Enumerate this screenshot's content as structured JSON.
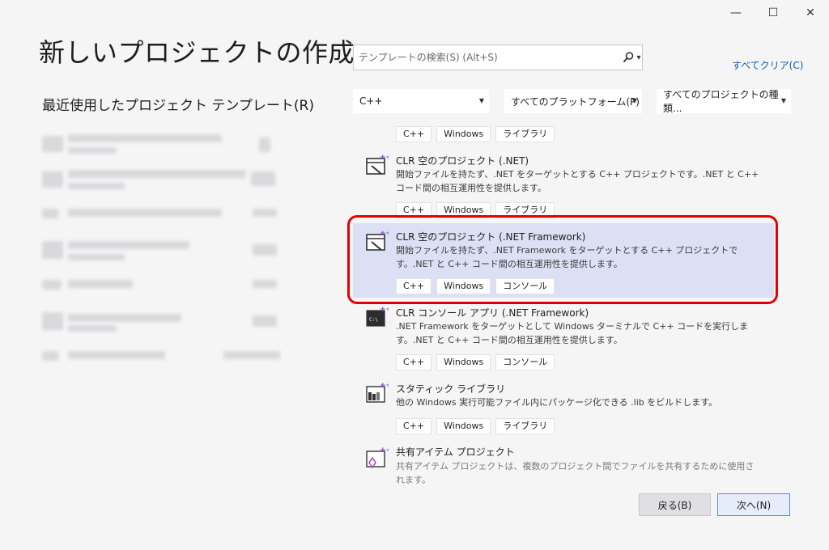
{
  "window": {
    "minimize": "—",
    "maximize": "☐",
    "close": "✕"
  },
  "page_title": "新しいプロジェクトの作成",
  "recent": {
    "title": "最近使用したプロジェクト テンプレート(R)"
  },
  "search": {
    "placeholder": "テンプレートの検索(S) (Alt+S)",
    "icon": "search-icon"
  },
  "clear_all": "すべてクリア(C)",
  "filters": {
    "language": "C++",
    "platform": "すべてのプラットフォーム(P)",
    "project_type": "すべてのプロジェクトの種類..."
  },
  "top_tags": [
    "C++",
    "Windows",
    "ライブラリ"
  ],
  "projects": [
    {
      "name": "CLR 空のプロジェクト (.NET)",
      "desc": "開始ファイルを持たず、.NET をターゲットとする C++ プロジェクトです。.NET と C++ コード間の相互運用性を提供します。",
      "tags": [
        "C++",
        "Windows",
        "ライブラリ"
      ],
      "icon": "clr-empty-project-icon"
    },
    {
      "name": "CLR 空のプロジェクト (.NET Framework)",
      "desc": "開始ファイルを持たず、.NET Framework をターゲットとする C++ プロジェクトです。.NET と C++ コード間の相互運用性を提供します。",
      "tags": [
        "C++",
        "Windows",
        "コンソール"
      ],
      "icon": "clr-empty-project-icon",
      "selected": true
    },
    {
      "name": "CLR コンソール アプリ (.NET Framework)",
      "desc": ".NET Framework をターゲットとして Windows ターミナルで C++ コードを実行します。.NET と C++ コード間の相互運用性を提供します。",
      "tags": [
        "C++",
        "Windows",
        "コンソール"
      ],
      "icon": "console-app-icon"
    },
    {
      "name": "スタティック ライブラリ",
      "desc": "他の Windows 実行可能ファイル内にパッケージ化できる .lib をビルドします。",
      "tags": [
        "C++",
        "Windows",
        "ライブラリ"
      ],
      "icon": "static-library-icon"
    },
    {
      "name": "共有アイテム プロジェクト",
      "desc": "共有アイテム プロジェクトは、複数のプロジェクト間でファイルを共有するために使用されます。",
      "tags": [],
      "icon": "shared-items-project-icon"
    }
  ],
  "buttons": {
    "back": "戻る(B)",
    "next": "次へ(N)"
  },
  "colors": {
    "accent": "#0e5fb5",
    "selected_bg": "#dbe0f5",
    "highlight": "#e30000",
    "icon_purple": "#8a3fbf"
  }
}
